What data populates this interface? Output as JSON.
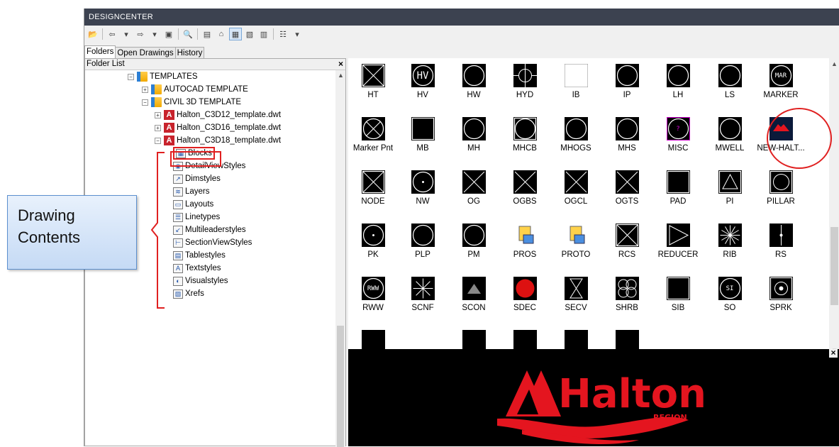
{
  "window": {
    "title": "DESIGNCENTER"
  },
  "tabs": [
    "Folders",
    "Open Drawings",
    "History"
  ],
  "folder_list": {
    "header": "Folder List",
    "close_glyph": "×"
  },
  "tree": [
    {
      "label": "TEMPLATES",
      "icon": "folder-icon"
    },
    {
      "label": "AUTOCAD TEMPLATE",
      "icon": "folder-icon"
    },
    {
      "label": "CIVIL 3D TEMPLATE",
      "icon": "folder-icon"
    },
    {
      "label": "Halton_C3D12_template.dwt",
      "icon": "dwg-icon"
    },
    {
      "label": "Halton_C3D16_template.dwt",
      "icon": "dwg-icon"
    },
    {
      "label": "Halton_C3D18_template.dwt",
      "icon": "dwg-icon"
    },
    {
      "label": "Blocks",
      "icon": "blocks-icon"
    },
    {
      "label": "DetailViewStyles",
      "icon": "detailviewstyles-icon"
    },
    {
      "label": "Dimstyles",
      "icon": "dimstyles-icon"
    },
    {
      "label": "Layers",
      "icon": "layers-icon"
    },
    {
      "label": "Layouts",
      "icon": "layouts-icon"
    },
    {
      "label": "Linetypes",
      "icon": "linetypes-icon"
    },
    {
      "label": "Multileaderstyles",
      "icon": "multileaderstyles-icon"
    },
    {
      "label": "SectionViewStyles",
      "icon": "sectionviewstyles-icon"
    },
    {
      "label": "Tablestyles",
      "icon": "tablestyles-icon"
    },
    {
      "label": "Textstyles",
      "icon": "textstyles-icon"
    },
    {
      "label": "Visualstyles",
      "icon": "visualstyles-icon"
    },
    {
      "label": "Xrefs",
      "icon": "xrefs-icon"
    }
  ],
  "blocks": [
    "HT",
    "HV",
    "HW",
    "HYD",
    "IB",
    "IP",
    "LH",
    "LS",
    "MARKER",
    "Marker Pnt",
    "MB",
    "MH",
    "MHCB",
    "MHOGS",
    "MHS",
    "MISC",
    "MWELL",
    "NEW-HALT...",
    "NODE",
    "NW",
    "OG",
    "OGBS",
    "OGCL",
    "OGTS",
    "PAD",
    "PI",
    "PILLAR",
    "PK",
    "PLP",
    "PM",
    "PROS",
    "PROTO",
    "RCS",
    "REDUCER",
    "RIB",
    "RS",
    "RWW",
    "SCNF",
    "SCON",
    "SDEC",
    "SECV",
    "SHRB",
    "SIB",
    "SO",
    "SPRK"
  ],
  "block_thumb_text": {
    "hv": "HV",
    "marker": "MAR",
    "misc": "?",
    "rww": "RWW",
    "so": "SI"
  },
  "preview": {
    "logo_main": "Halton",
    "logo_sub": "REGION",
    "close_glyph": "×"
  },
  "callout": {
    "line1": "Drawing",
    "line2": "Contents"
  },
  "colors": {
    "title_bg": "#3c4250",
    "accent": "#e02020",
    "callout_bg": "#d6e6f9"
  }
}
